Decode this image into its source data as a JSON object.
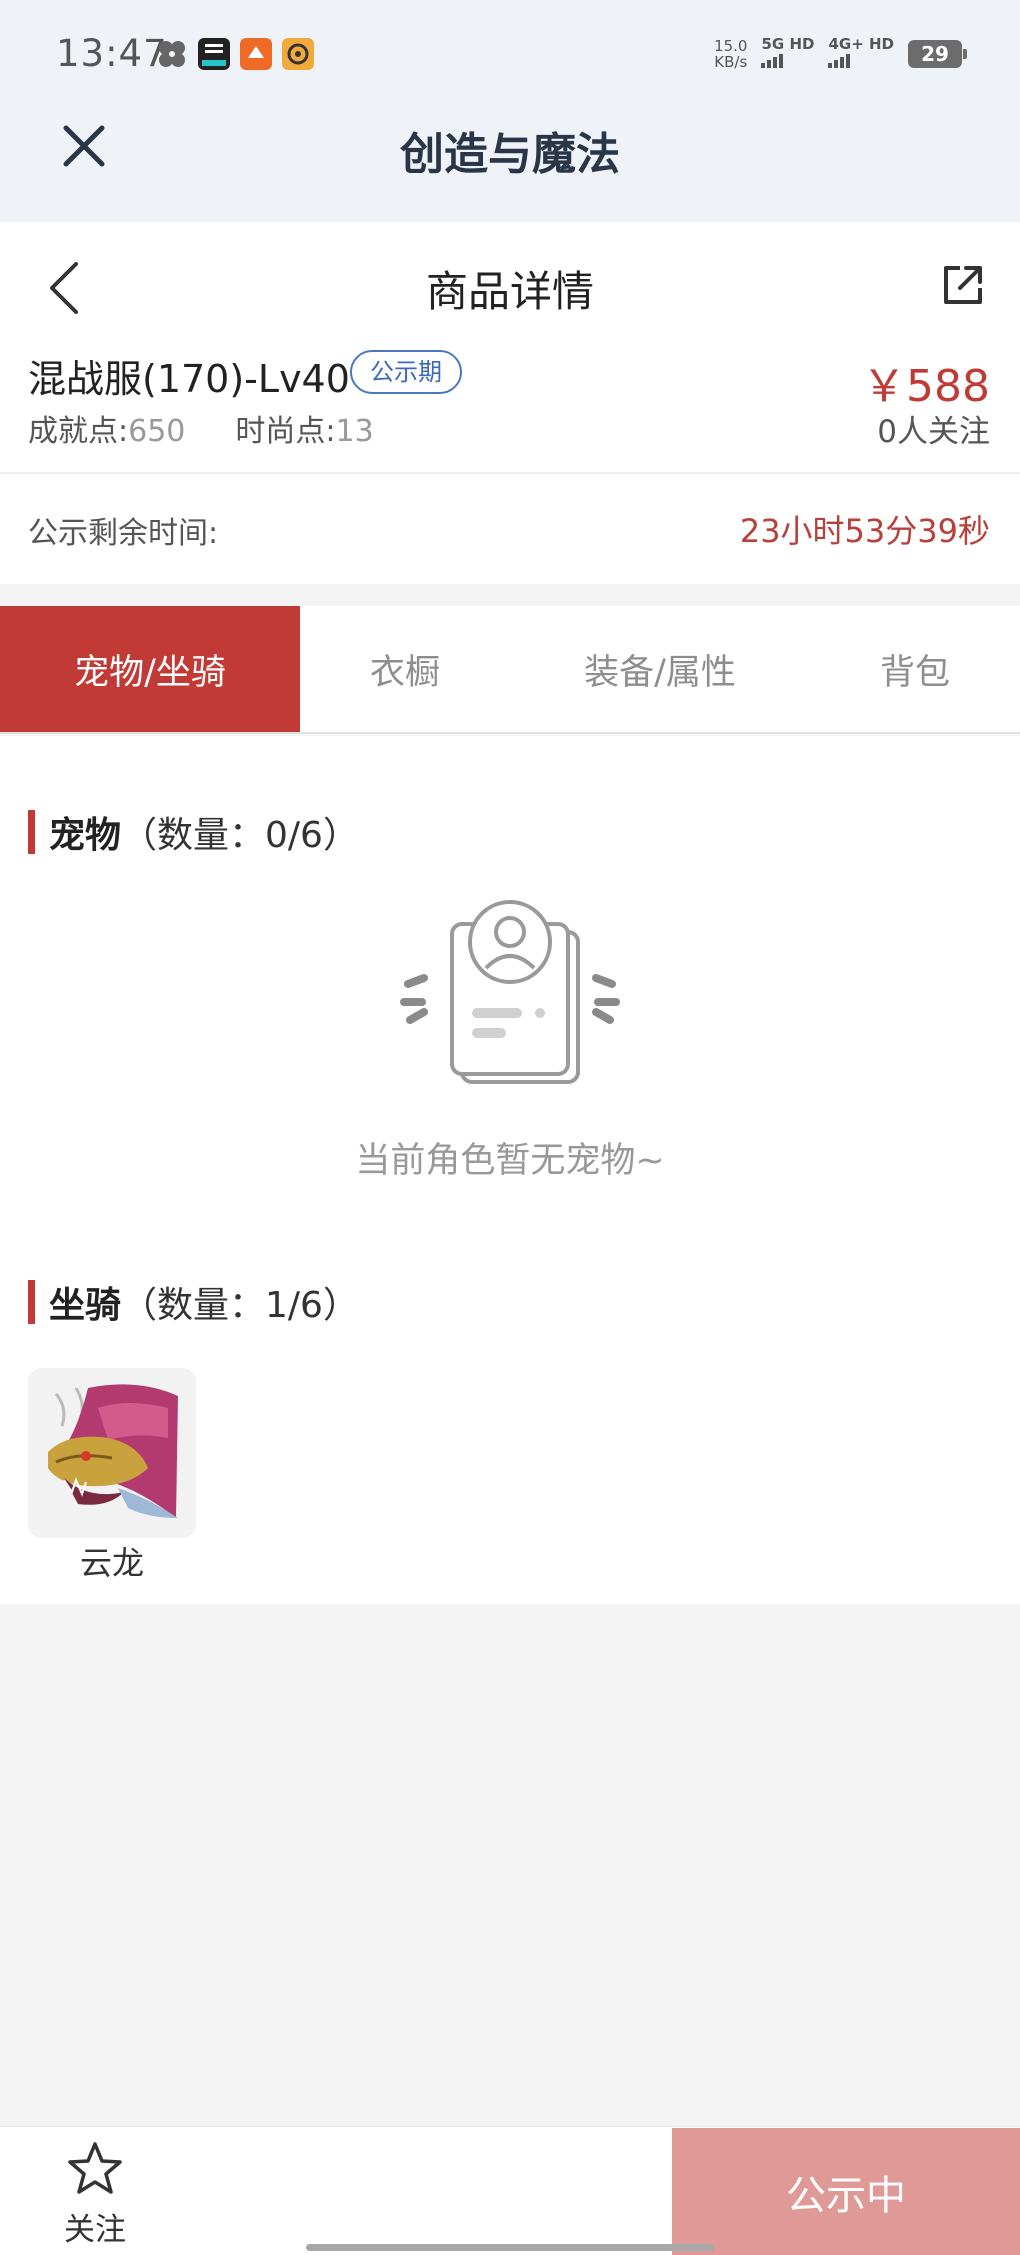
{
  "status_bar": {
    "time": "13:47",
    "net_speed_value": "15.0",
    "net_speed_unit": "KB/s",
    "sim1": "5G HD",
    "sim2": "4G+ HD",
    "battery": "29"
  },
  "app_bar": {
    "title": "创造与魔法",
    "close_icon": "close-icon"
  },
  "page": {
    "title": "商品详情",
    "back_icon": "chevron-left-icon",
    "share_icon": "share-icon"
  },
  "product": {
    "name": "混战服(170)-Lv40",
    "badge": "公示期",
    "price": "￥588",
    "achievement_label": "成就点:",
    "achievement_value": "650",
    "fashion_label": "时尚点:",
    "fashion_value": "13",
    "followers": "0人关注"
  },
  "countdown": {
    "label": "公示剩余时间:",
    "value": "23小时53分39秒"
  },
  "tabs": [
    {
      "label": "宠物/坐骑",
      "active": true
    },
    {
      "label": "衣橱",
      "active": false
    },
    {
      "label": "装备/属性",
      "active": false
    },
    {
      "label": "背包",
      "active": false
    }
  ],
  "pets": {
    "title": "宠物",
    "count": "（数量：0/6）",
    "empty_text": "当前角色暂无宠物~"
  },
  "mounts": {
    "title": "坐骑",
    "count": "（数量：1/6）",
    "items": [
      {
        "name": "云龙",
        "icon": "dragon-mount-icon"
      }
    ]
  },
  "bottom_bar": {
    "follow_label": "关注",
    "follow_icon": "star-icon",
    "action_label": "公示中"
  },
  "colors": {
    "accent": "#c23a35",
    "price": "#c03a36",
    "badge": "#3b6bb8",
    "disabled_action": "#df9a98"
  }
}
